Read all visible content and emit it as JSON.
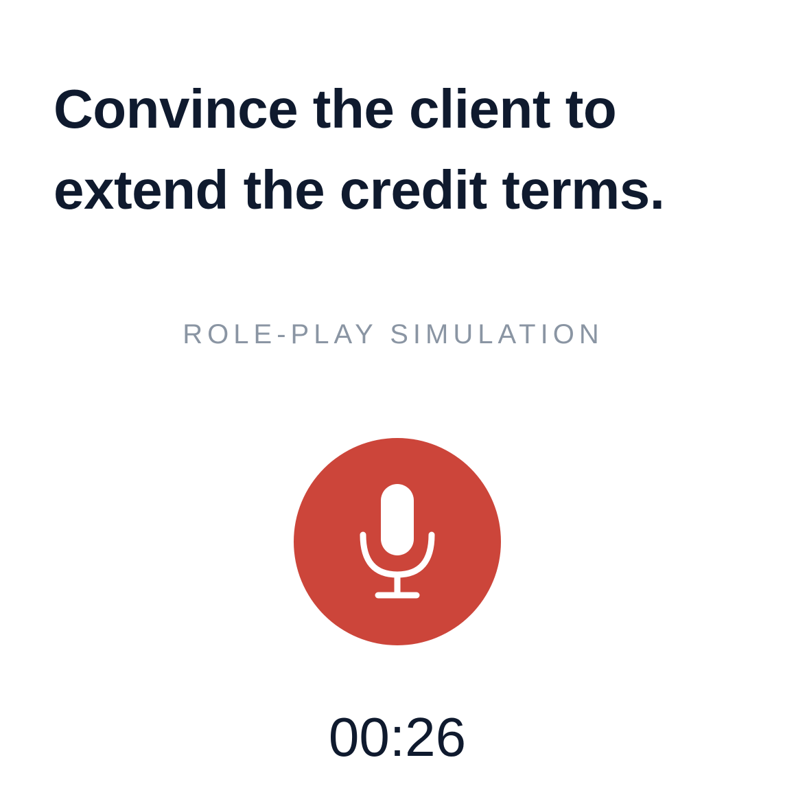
{
  "prompt": {
    "title": "Convince the client to extend the credit terms."
  },
  "mode": {
    "label": "ROLE-PLAY SIMULATION"
  },
  "mic": {
    "icon": "microphone-icon",
    "state": "recording",
    "color": "#cc453a"
  },
  "timer": {
    "elapsed": "00:26"
  },
  "colors": {
    "text_primary": "#0f1a2e",
    "text_muted": "#8a95a3",
    "accent": "#cc453a",
    "background": "#ffffff"
  }
}
